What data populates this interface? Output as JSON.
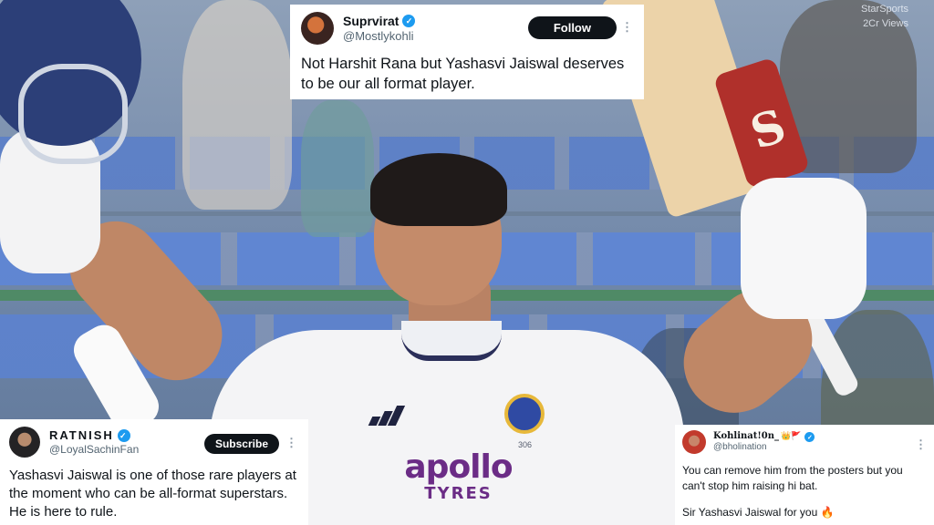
{
  "broadcast": {
    "channel": "StarSports",
    "views": "2Cr Views"
  },
  "photo": {
    "bat_brand": "S",
    "sponsor_main": "apollo",
    "sponsor_sub": "TYRES",
    "jersey_number": "306"
  },
  "tweets": [
    {
      "name": "Suprvirat",
      "handle": "@Mostlykohli",
      "verified": true,
      "button": "Follow",
      "more": "⋮",
      "text": "Not Harshit Rana but Yashasvi Jaiswal deserves to be our all format player."
    },
    {
      "name": "RATNISH",
      "handle": "@LoyalSachinFan",
      "verified": true,
      "button": "Subscribe",
      "more": "⋮",
      "text": "Yashasvi Jaiswal is one of those rare players at the moment who can be all-format superstars. He is here to rule."
    },
    {
      "name": "Kohlinat!0n_",
      "name_emoji": "👑🚩",
      "handle": "@bholination",
      "verified": true,
      "more": "⋮",
      "text": "You can remove him from the posters but you can't stop him raising hi bat.",
      "text2": "Sir Yashasvi Jaiswal for you 🔥"
    }
  ],
  "colors": {
    "verified": "#1d9bf0",
    "button_bg": "#0f1419",
    "handle": "#536471",
    "sponsor": "#6b2c86"
  },
  "icons": {
    "verified": "verified-badge-icon",
    "more": "more-options-icon"
  }
}
